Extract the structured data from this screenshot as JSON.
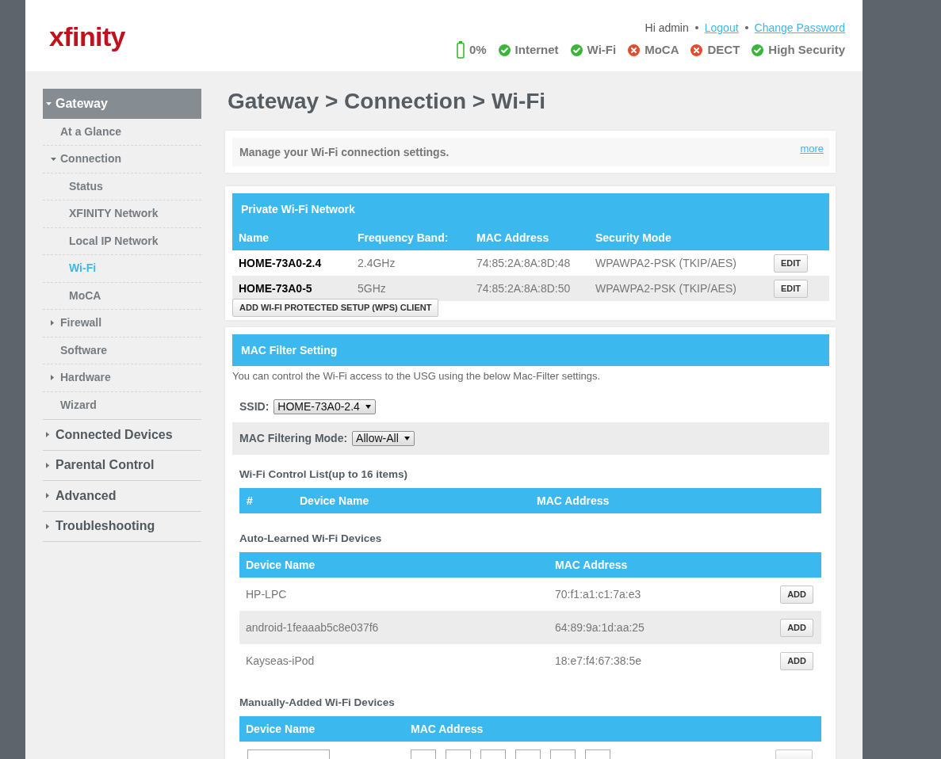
{
  "header": {
    "logo": "xfinity",
    "greeting": "Hi admin",
    "links": [
      "Logout",
      "Change Password"
    ],
    "status": [
      {
        "kind": "battery",
        "label": "0%"
      },
      {
        "kind": "service",
        "label": "Internet",
        "on": true
      },
      {
        "kind": "service",
        "label": "Wi-Fi",
        "on": true
      },
      {
        "kind": "service",
        "label": "MoCA",
        "on": false
      },
      {
        "kind": "service",
        "label": "DECT",
        "on": false
      },
      {
        "kind": "service",
        "label": "High Security",
        "on": true
      }
    ]
  },
  "sidebar": {
    "items": [
      {
        "label": "Gateway",
        "kind": "folder",
        "expanded": true,
        "selected": true,
        "children": [
          {
            "label": "At a Glance",
            "kind": "page",
            "selected": false
          },
          {
            "label": "Connection",
            "kind": "folder",
            "expanded": true,
            "selected": false,
            "children": [
              {
                "label": "Status",
                "kind": "page",
                "selected": false
              },
              {
                "label": "XFINITY Network",
                "kind": "page",
                "selected": false
              },
              {
                "label": "Local IP Network",
                "kind": "page",
                "selected": false
              },
              {
                "label": "Wi-Fi",
                "kind": "page",
                "selected": true
              },
              {
                "label": "MoCA",
                "kind": "page",
                "selected": false
              }
            ]
          },
          {
            "label": "Firewall",
            "kind": "folder",
            "expanded": false,
            "selected": false
          },
          {
            "label": "Software",
            "kind": "page",
            "selected": false
          },
          {
            "label": "Hardware",
            "kind": "folder",
            "expanded": false,
            "selected": false
          },
          {
            "label": "Wizard",
            "kind": "page",
            "selected": false
          }
        ]
      },
      {
        "label": "Connected Devices",
        "kind": "folder",
        "expanded": false,
        "selected": false
      },
      {
        "label": "Parental Control",
        "kind": "folder",
        "expanded": false,
        "selected": false
      },
      {
        "label": "Advanced",
        "kind": "folder",
        "expanded": false,
        "selected": false
      },
      {
        "label": "Troubleshooting",
        "kind": "folder",
        "expanded": false,
        "selected": false
      }
    ]
  },
  "page_title": "Gateway > Connection > Wi-Fi",
  "intro": {
    "text": "Manage your Wi-Fi connection settings.",
    "link": "more"
  },
  "private_network": {
    "title": "Private Wi-Fi Network",
    "columns": [
      "Name",
      "Frequency Band:",
      "MAC Address",
      "Security Mode"
    ],
    "rows": [
      {
        "name": "HOME-73A0-2.4",
        "band": "2.4GHz",
        "mac": "74:85:2A:8A:8D:48",
        "security": "WPAWPA2-PSK (TKIP/AES)",
        "action": "EDIT"
      },
      {
        "name": "HOME-73A0-5",
        "band": "5GHz",
        "mac": "74:85:2A:8A:8D:50",
        "security": "WPAWPA2-PSK (TKIP/AES)",
        "action": "EDIT"
      }
    ],
    "wps_button": "ADD WI-FI PROTECTED SETUP (WPS) CLIENT"
  },
  "mac_filter": {
    "title": "MAC Filter Setting",
    "description": "You can control the Wi-Fi access to the USG using the below Mac-Filter settings.",
    "ssid": {
      "label": "SSID:",
      "value": "HOME-73A0-2.4"
    },
    "mode": {
      "label": "MAC Filtering Mode:",
      "value": "Allow-All"
    },
    "control_list": {
      "title": "Wi-Fi Control List(up to 16 items)",
      "columns": [
        "#",
        "Device Name",
        "MAC Address"
      ]
    },
    "auto_learned": {
      "title": "Auto-Learned Wi-Fi Devices",
      "columns": [
        "Device Name",
        "MAC Address"
      ],
      "rows": [
        {
          "device": "HP-LPC",
          "mac": "70:f1:a1:c1:7a:e3",
          "action": "ADD"
        },
        {
          "device": "android-1feaaab5c8e037f6",
          "mac": "64:89:9a:1d:aa:25",
          "action": "ADD"
        },
        {
          "device": "Kayseas-iPod",
          "mac": "18:e7:f4:67:38:5e",
          "action": "ADD"
        }
      ]
    },
    "manual": {
      "title": "Manually-Added Wi-Fi Devices",
      "columns": [
        "Device Name",
        "MAC Address"
      ],
      "inputs": [
        {
          "kind": "text"
        },
        {
          "kind": "octet"
        },
        {
          "kind": "octet"
        },
        {
          "kind": "octet"
        },
        {
          "kind": "octet"
        },
        {
          "kind": "octet"
        },
        {
          "kind": "octet"
        },
        {
          "kind": "button"
        }
      ]
    }
  }
}
